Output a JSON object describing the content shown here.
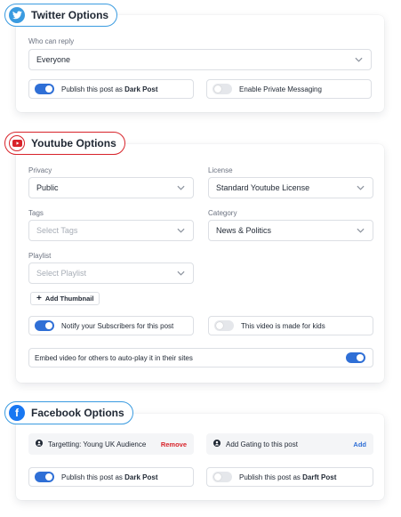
{
  "colors": {
    "twitter_blue": "#3a9be0",
    "youtube_red": "#d8232a",
    "facebook_blue": "#1877f2",
    "toggle_on": "#2f6fd6",
    "remove_red": "#d8232a",
    "add_blue": "#2f6fd6"
  },
  "twitter": {
    "title": "Twitter Options",
    "icon": "twitter-bird-icon",
    "who_can_reply_label": "Who can reply",
    "who_can_reply_value": "Everyone",
    "dark_post": {
      "prefix": "Publish this post as ",
      "bold": "Dark Post",
      "enabled": true
    },
    "private_messaging": {
      "label": "Enable Private Messaging",
      "enabled": false
    }
  },
  "youtube": {
    "title": "Youtube Options",
    "icon": "youtube-play-icon",
    "privacy_label": "Privacy",
    "privacy_value": "Public",
    "license_label": "License",
    "license_value": "Standard Youtube License",
    "tags_label": "Tags",
    "tags_placeholder": "Select Tags",
    "category_label": "Category",
    "category_value": "News & Politics",
    "playlist_label": "Playlist",
    "playlist_placeholder": "Select Playlist",
    "add_thumbnail": "Add Thumbnail",
    "notify": {
      "label": "Notify your Subscribers for this post",
      "enabled": true
    },
    "made_for_kids": {
      "label": "This video is made for kids",
      "enabled": false
    },
    "embed": {
      "label": "Embed video for others to auto-play it in their sites",
      "enabled": true
    }
  },
  "facebook": {
    "title": "Facebook Options",
    "icon": "facebook-f-icon",
    "targeting": {
      "label": "Targetting: Young UK Audience",
      "action": "Remove"
    },
    "gating": {
      "label": "Add Gating to this post",
      "action": "Add"
    },
    "dark_post": {
      "prefix": "Publish this post as ",
      "bold": "Dark Post",
      "enabled": true
    },
    "darft_post": {
      "prefix": "Publish this post as ",
      "bold": "Darft Post",
      "enabled": false
    }
  }
}
